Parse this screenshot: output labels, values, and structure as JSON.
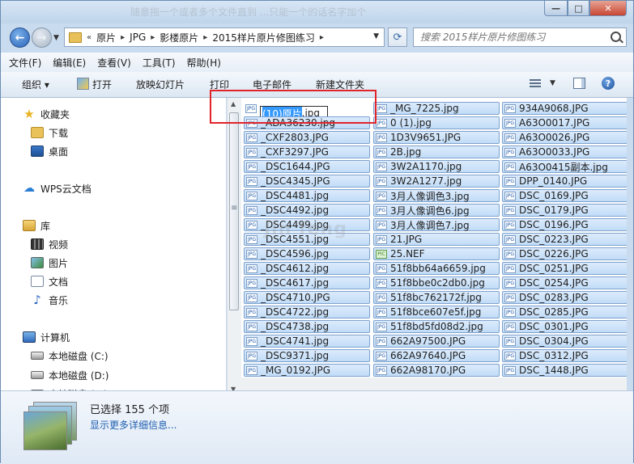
{
  "window": {
    "title_ghost": "随意拖一个或者多个文件直到 ...只能一个的话名字加个",
    "controls": {
      "minimize": "—",
      "maximize": "□",
      "close": "✕"
    }
  },
  "address": {
    "overflow": "«",
    "crumbs": [
      "原片",
      "JPG",
      "影楼原片",
      "2015样片原片修图练习"
    ]
  },
  "search": {
    "placeholder": "搜索 2015样片原片修图练习"
  },
  "menu": [
    "文件(F)",
    "编辑(E)",
    "查看(V)",
    "工具(T)",
    "帮助(H)"
  ],
  "commands": {
    "organize": "组织 ▾",
    "open": "打开",
    "slideshow": "放映幻灯片",
    "print": "打印",
    "email": "电子邮件",
    "new_folder": "新建文件夹"
  },
  "nav": {
    "favorites": "收藏夹",
    "downloads": "下载",
    "desktop": "桌面",
    "wps": "WPS云文档",
    "libraries": "库",
    "videos": "视频",
    "pictures": "图片",
    "documents": "文档",
    "music": "音乐",
    "computer": "计算机",
    "drive_c": "本地磁盘 (C:)",
    "drive_d": "本地磁盘 (D:)",
    "drive_e": "本地磁盘 (E:)"
  },
  "rename": {
    "selected": "(10)原片",
    "ext": ".jpg"
  },
  "watermark": "Jin feng",
  "columns": [
    [
      "(10)原片.jpg",
      "_ADA36230.jpg",
      "_CXF2803.JPG",
      "_CXF3297.JPG",
      "_DSC1644.JPG",
      "_DSC4345.JPG",
      "_DSC4481.jpg",
      "_DSC4492.jpg",
      "_DSC4499.jpg",
      "_DSC4551.jpg",
      "_DSC4596.jpg",
      "_DSC4612.jpg",
      "_DSC4617.jpg",
      "_DSC4710.JPG",
      "_DSC4722.jpg",
      "_DSC4738.jpg",
      "_DSC4741.jpg",
      "_DSC9371.jpg",
      "_MG_0192.JPG"
    ],
    [
      "_MG_7225.jpg",
      "0 (1).jpg",
      "1D3V9651.JPG",
      "2B.jpg",
      "3W2A1170.jpg",
      "3W2A1277.jpg",
      "3月人像调色3.jpg",
      "3月人像调色6.jpg",
      "3月人像调色7.jpg",
      "21.JPG",
      "25.NEF",
      "51f8bb64a6659.jpg",
      "51f8bbe0c2db0.jpg",
      "51f8bc762172f.jpg",
      "51f8bce607e5f.jpg",
      "51f8bd5fd08d2.jpg",
      "662A97500.JPG",
      "662A97640.JPG",
      "662A98170.JPG"
    ],
    [
      "934A9068.JPG",
      "A63O0017.JPG",
      "A63O0026.JPG",
      "A63O0033.JPG",
      "A63O0415副本.jpg",
      "DPP_0140.JPG",
      "DSC_0169.JPG",
      "DSC_0179.JPG",
      "DSC_0196.JPG",
      "DSC_0223.JPG",
      "DSC_0226.JPG",
      "DSC_0251.JPG",
      "DSC_0254.JPG",
      "DSC_0283.JPG",
      "DSC_0285.JPG",
      "DSC_0301.JPG",
      "DSC_0304.JPG",
      "DSC_0312.JPG",
      "DSC_1448.JPG"
    ]
  ],
  "icons": {
    "jpg": "JPG",
    "nef": "PIC"
  },
  "details": {
    "selected_count": "已选择 155 个项",
    "more": "显示更多详细信息..."
  },
  "colors": {
    "selection": "#c1dcf7",
    "highlight_box": "#e0242a",
    "link": "#1f5fb0"
  }
}
